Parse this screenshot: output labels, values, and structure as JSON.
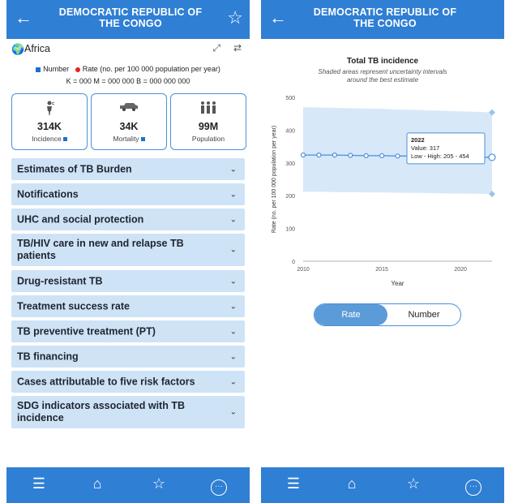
{
  "header": {
    "title": "DEMOCRATIC REPUBLIC OF THE CONGO",
    "back_icon": "←",
    "star_icon": "☆"
  },
  "region": {
    "name": "Africa",
    "globe_icon": "🌍",
    "expand_icon": "⤢",
    "compare_icon": "⇄"
  },
  "legend": {
    "number_label": "Number",
    "rate_label": "Rate (no. per 100 000 population per year)",
    "units": "K = 000   M = 000 000   B = 000 000 000",
    "number_color": "#1f6fd0",
    "rate_color": "#e2231a"
  },
  "stats": [
    {
      "value": "314K",
      "label": "Incidence",
      "icon": "person-coughing-icon",
      "marker": "number"
    },
    {
      "value": "34K",
      "label": "Mortality",
      "icon": "hearse-icon",
      "marker": "number"
    },
    {
      "value": "99M",
      "label": "Population",
      "icon": "people-group-icon",
      "marker": null
    }
  ],
  "sections": [
    "Estimates of TB Burden",
    "Notifications",
    "UHC and social protection",
    "TB/HIV care in new and relapse TB patients",
    "Drug-resistant TB",
    "Treatment success rate",
    "TB preventive treatment (PT)",
    "TB financing",
    "Cases attributable to five risk factors",
    "SDG indicators associated with TB incidence"
  ],
  "nav": {
    "menu": "☰",
    "home": "⌂",
    "favorites": "☆",
    "more": "···"
  },
  "chart_panel": {
    "title": "Total TB incidence",
    "subtitle": "Shaded areas represent uncertainty intervals around the best estimate",
    "toggle": {
      "rate": "Rate",
      "number": "Number",
      "selected": "Rate"
    },
    "tooltip": {
      "year": "2022",
      "value_line": "Value: 317",
      "range_line": "Low - High: 205 - 454"
    }
  },
  "chart_data": {
    "type": "line",
    "title": "Total TB incidence",
    "xlabel": "Year",
    "ylabel": "Rate (no. per 100 000 population per year)",
    "x": [
      2010,
      2011,
      2012,
      2013,
      2014,
      2015,
      2016,
      2017,
      2018,
      2019,
      2020,
      2021,
      2022
    ],
    "values": [
      324,
      324,
      324,
      323,
      322,
      322,
      321,
      321,
      320,
      319,
      318,
      318,
      317
    ],
    "low": [
      212,
      212,
      211,
      211,
      210,
      210,
      209,
      209,
      208,
      207,
      206,
      206,
      205
    ],
    "high": [
      470,
      469,
      468,
      467,
      466,
      465,
      463,
      462,
      460,
      459,
      457,
      456,
      454
    ],
    "xlim": [
      2010,
      2022
    ],
    "ylim": [
      0,
      500
    ],
    "xticks": [
      2010,
      2015,
      2020
    ],
    "yticks": [
      0,
      100,
      200,
      300,
      400,
      500
    ],
    "line_color": "#4a90d9",
    "band_color": "#d7e8f8"
  }
}
